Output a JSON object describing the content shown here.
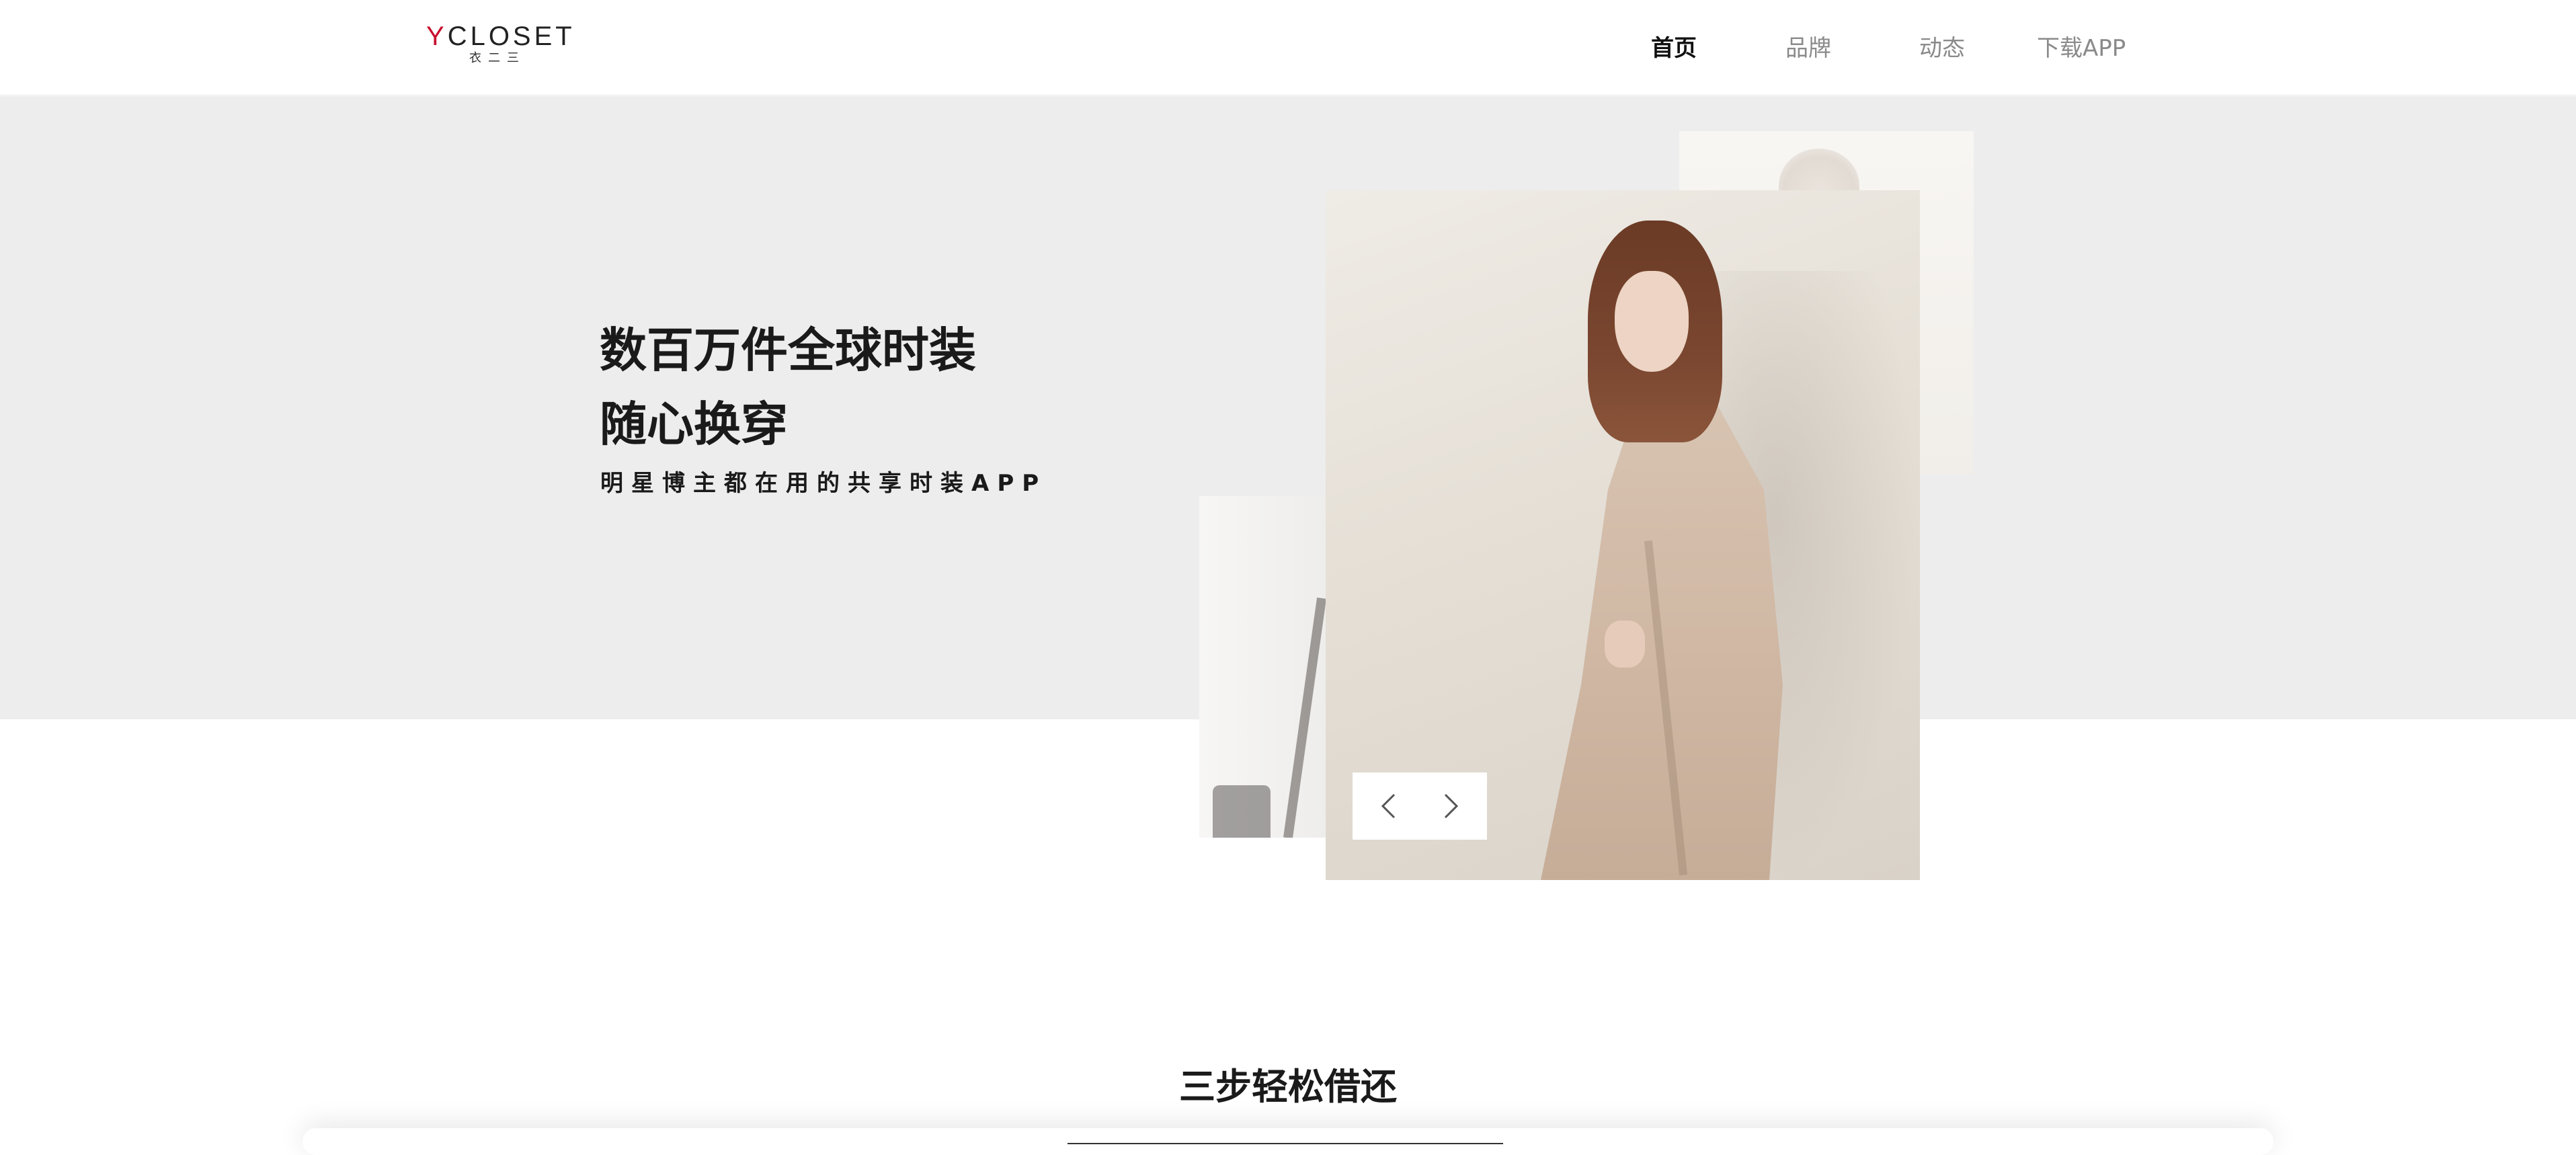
{
  "header": {
    "logo": {
      "main": "YCLOSET",
      "sub": "衣二三"
    },
    "nav": [
      {
        "label": "首页",
        "active": true
      },
      {
        "label": "品牌",
        "active": false
      },
      {
        "label": "动态",
        "active": false
      },
      {
        "label": "下载APP",
        "active": false
      }
    ]
  },
  "hero": {
    "title_line1": "数百万件全球时装",
    "title_line2": "随心换穿",
    "subtitle": "明星博主都在用的共享时装APP",
    "background_color": "#ededed",
    "carousel": {
      "prev_icon": "chevron-left-icon",
      "next_icon": "chevron-right-icon"
    }
  },
  "section": {
    "title": "三步轻松借还"
  },
  "colors": {
    "accent": "#c8102e",
    "text": "#1a1a1a",
    "nav_inactive": "#8a8a8a"
  }
}
